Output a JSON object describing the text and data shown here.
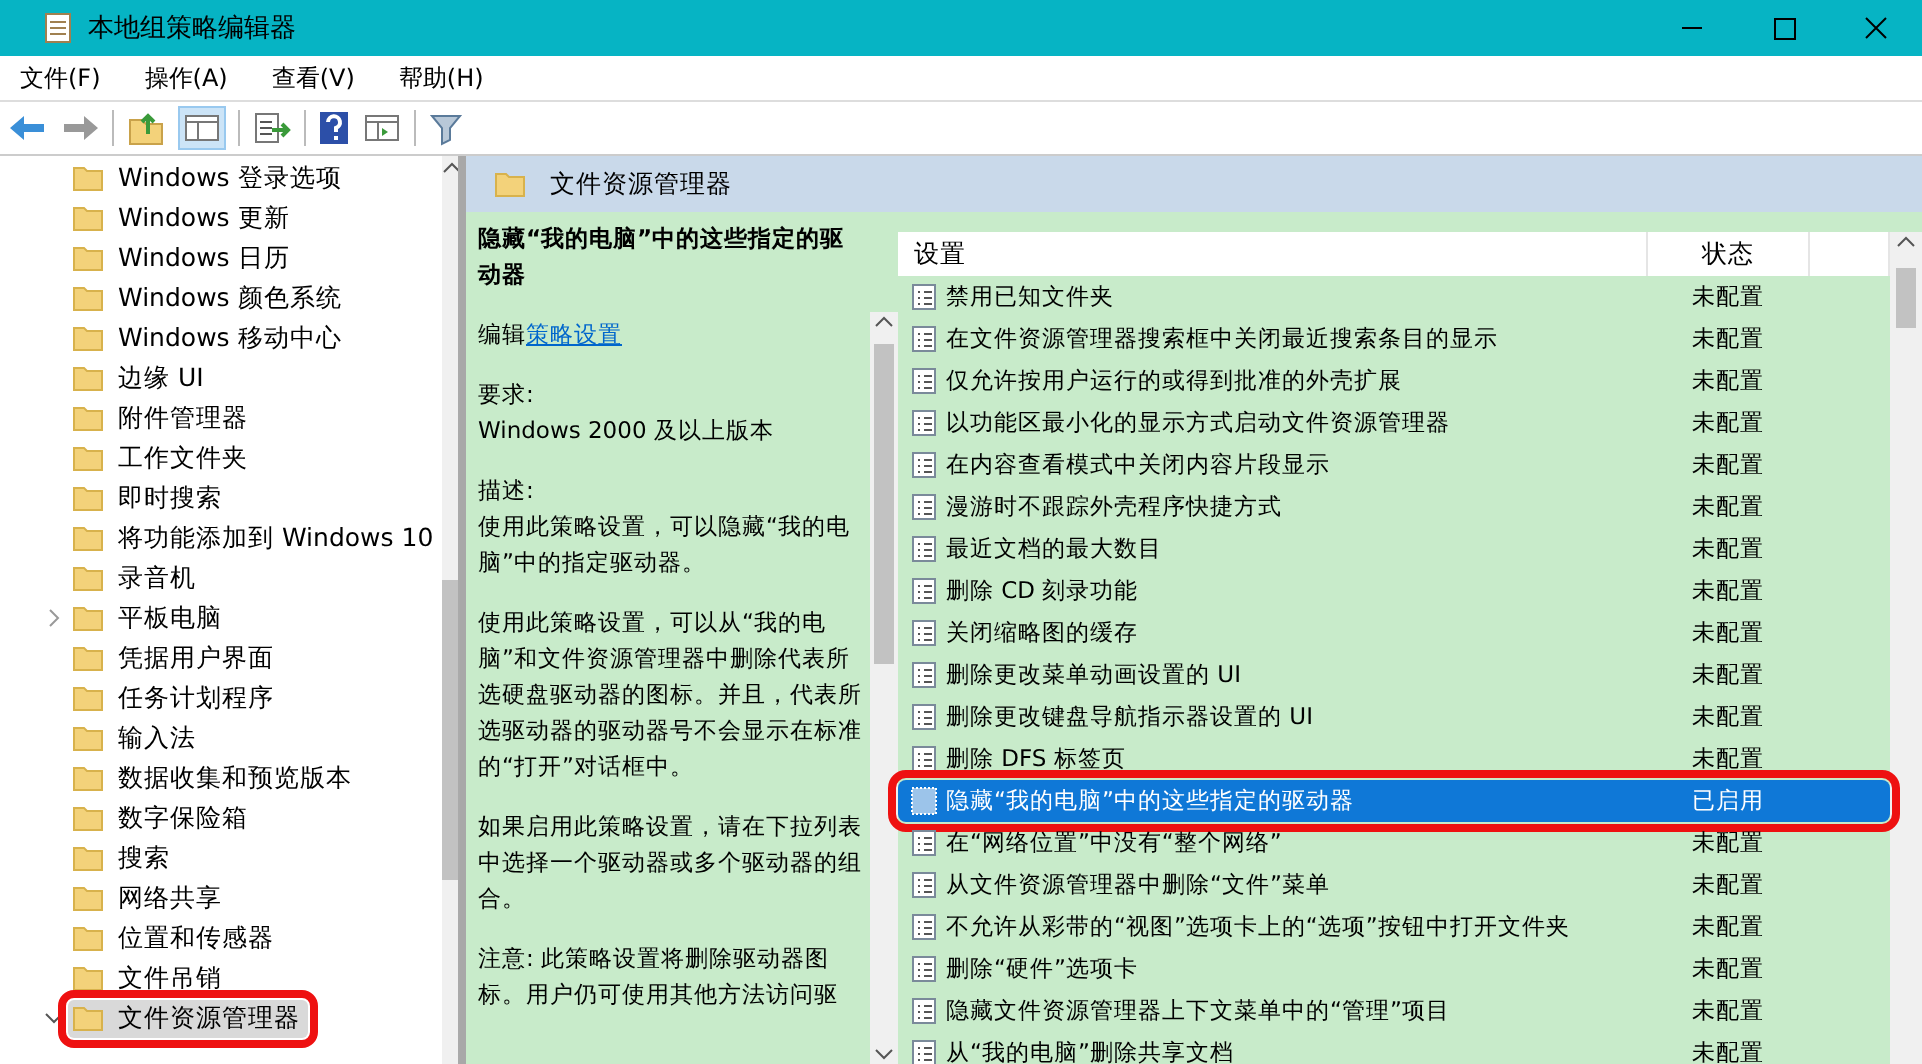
{
  "window": {
    "title": "本地组策略编辑器"
  },
  "menu": [
    "文件(F)",
    "操作(A)",
    "查看(V)",
    "帮助(H)"
  ],
  "tree": {
    "items": [
      {
        "label": "Windows 登录选项",
        "selected": false,
        "annotated": false
      },
      {
        "label": "Windows 更新",
        "selected": false,
        "annotated": false
      },
      {
        "label": "Windows 日历",
        "selected": false,
        "annotated": false
      },
      {
        "label": "Windows 颜色系统",
        "selected": false,
        "annotated": false
      },
      {
        "label": "Windows 移动中心",
        "selected": false,
        "annotated": false
      },
      {
        "label": "边缘 UI",
        "selected": false,
        "annotated": false
      },
      {
        "label": "附件管理器",
        "selected": false,
        "annotated": false
      },
      {
        "label": "工作文件夹",
        "selected": false,
        "annotated": false
      },
      {
        "label": "即时搜索",
        "selected": false,
        "annotated": false
      },
      {
        "label": "将功能添加到 Windows 10",
        "selected": false,
        "annotated": false
      },
      {
        "label": "录音机",
        "selected": false,
        "annotated": false
      },
      {
        "label": "平板电脑",
        "selected": false,
        "annotated": false,
        "expanded": false
      },
      {
        "label": "凭据用户界面",
        "selected": false,
        "annotated": false
      },
      {
        "label": "任务计划程序",
        "selected": false,
        "annotated": false
      },
      {
        "label": "输入法",
        "selected": false,
        "annotated": false
      },
      {
        "label": "数据收集和预览版本",
        "selected": false,
        "annotated": false
      },
      {
        "label": "数字保险箱",
        "selected": false,
        "annotated": false
      },
      {
        "label": "搜索",
        "selected": false,
        "annotated": false
      },
      {
        "label": "网络共享",
        "selected": false,
        "annotated": false
      },
      {
        "label": "位置和传感器",
        "selected": false,
        "annotated": false
      },
      {
        "label": "文件吊销",
        "selected": false,
        "annotated": false
      },
      {
        "label": "文件资源管理器",
        "selected": true,
        "annotated": true,
        "expanded": true
      }
    ]
  },
  "details": {
    "header": "文件资源管理器",
    "title": "隐藏“我的电脑”中的这些指定的驱动器",
    "edit_prefix": "编辑",
    "edit_link": "策略设置",
    "paragraphs": [
      "要求:\nWindows 2000 及以上版本",
      "描述:\n使用此策略设置，可以隐藏“我的电脑”中的指定驱动器。",
      "使用此策略设置，可以从“我的电脑”和文件资源管理器中删除代表所选硬盘驱动器的图标。并且，代表所选驱动器的驱动器号不会显示在标准的“打开”对话框中。",
      "如果启用此策略设置，请在下拉列表中选择一个驱动器或多个驱动器的组合。",
      "注意: 此策略设置将删除驱动器图标。用户仍可使用其他方法访问驱"
    ]
  },
  "table": {
    "columns": [
      "设置",
      "状态"
    ],
    "rows": [
      {
        "name": "禁用已知文件夹",
        "state": "未配置",
        "selected": false,
        "annotated": false
      },
      {
        "name": "在文件资源管理器搜索框中关闭最近搜索条目的显示",
        "state": "未配置",
        "selected": false,
        "annotated": false
      },
      {
        "name": "仅允许按用户运行的或得到批准的外壳扩展",
        "state": "未配置",
        "selected": false,
        "annotated": false
      },
      {
        "name": "以功能区最小化的显示方式启动文件资源管理器",
        "state": "未配置",
        "selected": false,
        "annotated": false
      },
      {
        "name": "在内容查看模式中关闭内容片段显示",
        "state": "未配置",
        "selected": false,
        "annotated": false
      },
      {
        "name": "漫游时不跟踪外壳程序快捷方式",
        "state": "未配置",
        "selected": false,
        "annotated": false
      },
      {
        "name": "最近文档的最大数目",
        "state": "未配置",
        "selected": false,
        "annotated": false
      },
      {
        "name": "删除 CD 刻录功能",
        "state": "未配置",
        "selected": false,
        "annotated": false
      },
      {
        "name": "关闭缩略图的缓存",
        "state": "未配置",
        "selected": false,
        "annotated": false
      },
      {
        "name": "删除更改菜单动画设置的 UI",
        "state": "未配置",
        "selected": false,
        "annotated": false
      },
      {
        "name": "删除更改键盘导航指示器设置的 UI",
        "state": "未配置",
        "selected": false,
        "annotated": false
      },
      {
        "name": "删除 DFS 标签页",
        "state": "未配置",
        "selected": false,
        "annotated": false
      },
      {
        "name": "隐藏“我的电脑”中的这些指定的驱动器",
        "state": "已启用",
        "selected": true,
        "annotated": true
      },
      {
        "name": "在“网络位置”中没有“整个网络”",
        "state": "未配置",
        "selected": false,
        "annotated": false
      },
      {
        "name": "从文件资源管理器中删除“文件”菜单",
        "state": "未配置",
        "selected": false,
        "annotated": false
      },
      {
        "name": "不允许从彩带的“视图”选项卡上的“选项”按钮中打开文件夹",
        "state": "未配置",
        "selected": false,
        "annotated": false
      },
      {
        "name": "删除“硬件”选项卡",
        "state": "未配置",
        "selected": false,
        "annotated": false
      },
      {
        "name": "隐藏文件资源管理器上下文菜单中的“管理”项目",
        "state": "未配置",
        "selected": false,
        "annotated": false
      },
      {
        "name": "从“我的电脑”删除共享文档",
        "state": "未配置",
        "selected": false,
        "annotated": false
      }
    ]
  }
}
